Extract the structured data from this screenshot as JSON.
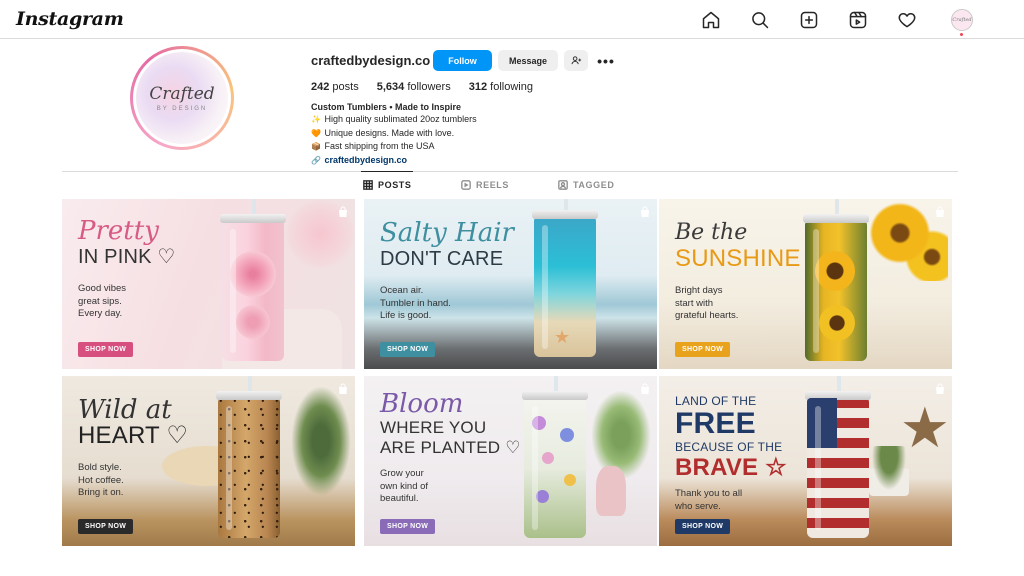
{
  "app": {
    "logo": "Instagram"
  },
  "nav": {
    "avatar_text": "Crafted"
  },
  "profile": {
    "avatar_title": "Crafted",
    "avatar_sub": "BY DESIGN",
    "username": "craftedbydesign.co",
    "follow_label": "Follow",
    "message_label": "Message",
    "stats": {
      "posts_count": "242",
      "posts_label": "posts",
      "followers_count": "5,634",
      "followers_label": "followers",
      "following_count": "312",
      "following_label": "following"
    },
    "bio": {
      "name": "Custom Tumblers • Made to Inspire",
      "line1_emoji": "✨",
      "line1": "High quality sublimated 20oz tumblers",
      "line2_emoji": "🧡",
      "line2": "Unique designs. Made with love.",
      "line3_emoji": "📦",
      "line3": "Fast shipping from the USA",
      "link": "craftedbydesign.co"
    }
  },
  "tabs": {
    "posts": "POSTS",
    "reels": "REELS",
    "tagged": "TAGGED"
  },
  "posts": [
    {
      "script": "Pretty",
      "caps": "IN PINK ♡",
      "body1": "Good vibes",
      "body2": "great sips.",
      "body3": "Every day.",
      "shop": "SHOP NOW",
      "accent": "#d64f7e",
      "bg": "#f7e3e6"
    },
    {
      "script": "Salty Hair",
      "caps": "DON'T CARE",
      "body1": "Ocean air.",
      "body2": "Tumbler in hand.",
      "body3": "Life is good.",
      "shop": "SHOP NOW",
      "accent": "#3e8fa0",
      "bg": "#dfeef3"
    },
    {
      "script": "Be the",
      "caps": "SUNSHINE",
      "body1": "Bright days",
      "body2": "start with",
      "body3": "grateful hearts.",
      "shop": "SHOP NOW",
      "accent": "#e8a21c",
      "bg": "#f7f2e7"
    },
    {
      "script": "Wild at",
      "caps": "HEART ♡",
      "body1": "Bold style.",
      "body2": "Hot coffee.",
      "body3": "Bring it on.",
      "shop": "SHOP NOW",
      "accent": "#2a2a2a",
      "bg": "#ebe4da"
    },
    {
      "script": "Bloom",
      "caps": "WHERE YOU",
      "caps2": "ARE PLANTED ♡",
      "body1": "Grow your",
      "body2": "own kind of",
      "body3": "beautiful.",
      "shop": "SHOP NOW",
      "accent": "#8a6bb8",
      "bg": "#f1eef0"
    },
    {
      "caps": "LAND OF THE",
      "big1": "FREE",
      "caps2": "BECAUSE OF THE",
      "big2": "BRAVE ☆",
      "body1": "Thank you to all",
      "body2": "who serve.",
      "shop": "SHOP NOW",
      "accent": "#1f3a66",
      "bg": "#f0ebe4"
    }
  ]
}
